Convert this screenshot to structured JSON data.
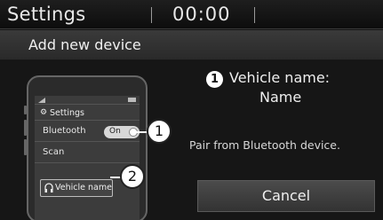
{
  "statusbar": {
    "title": "Settings",
    "clock": "00:00"
  },
  "dialog": {
    "title": "Add new device"
  },
  "phone": {
    "settings_label": "Settings",
    "bluetooth_label": "Bluetooth",
    "toggle_label": "On",
    "scan_label": "Scan",
    "device_label": "Vehicle name"
  },
  "callouts": {
    "one": "1",
    "two": "2"
  },
  "vehicle": {
    "badge": "1",
    "label": "Vehicle name:",
    "value": "Name"
  },
  "instruction": "Pair from Bluetooth device.",
  "cancel_label": "Cancel"
}
